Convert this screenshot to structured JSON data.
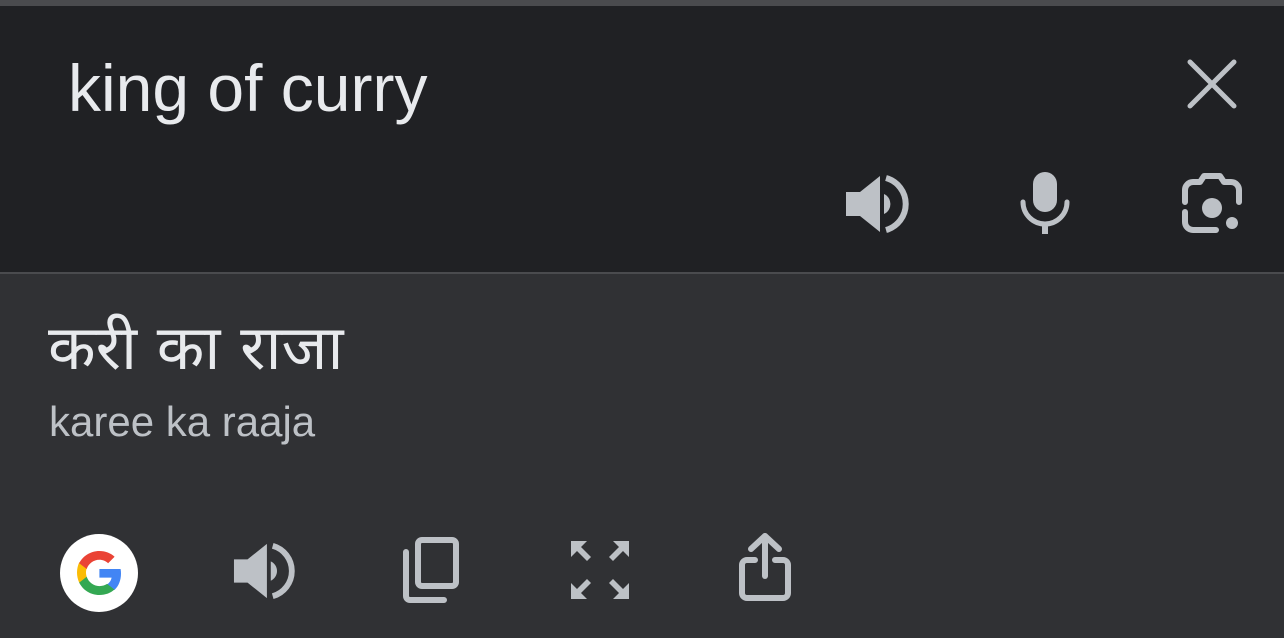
{
  "input": {
    "text": "king of curry",
    "clear_icon": "close-icon",
    "actions": [
      "speaker-icon",
      "microphone-icon",
      "camera-lens-icon"
    ]
  },
  "output": {
    "translation": "करी का राजा",
    "transliteration": "karee ka raaja",
    "actions": [
      "google-logo-icon",
      "speaker-icon",
      "copy-icon",
      "fullscreen-icon",
      "share-icon"
    ]
  },
  "colors": {
    "input_bg": "#202124",
    "output_bg": "#303134",
    "text_primary": "#e8eaed",
    "text_secondary": "#bdc1c6",
    "icon": "#9aa0a6",
    "divider": "#4a4b4e",
    "google_blue": "#4285F4",
    "google_red": "#EA4335",
    "google_yellow": "#FBBC05",
    "google_green": "#34A853"
  }
}
